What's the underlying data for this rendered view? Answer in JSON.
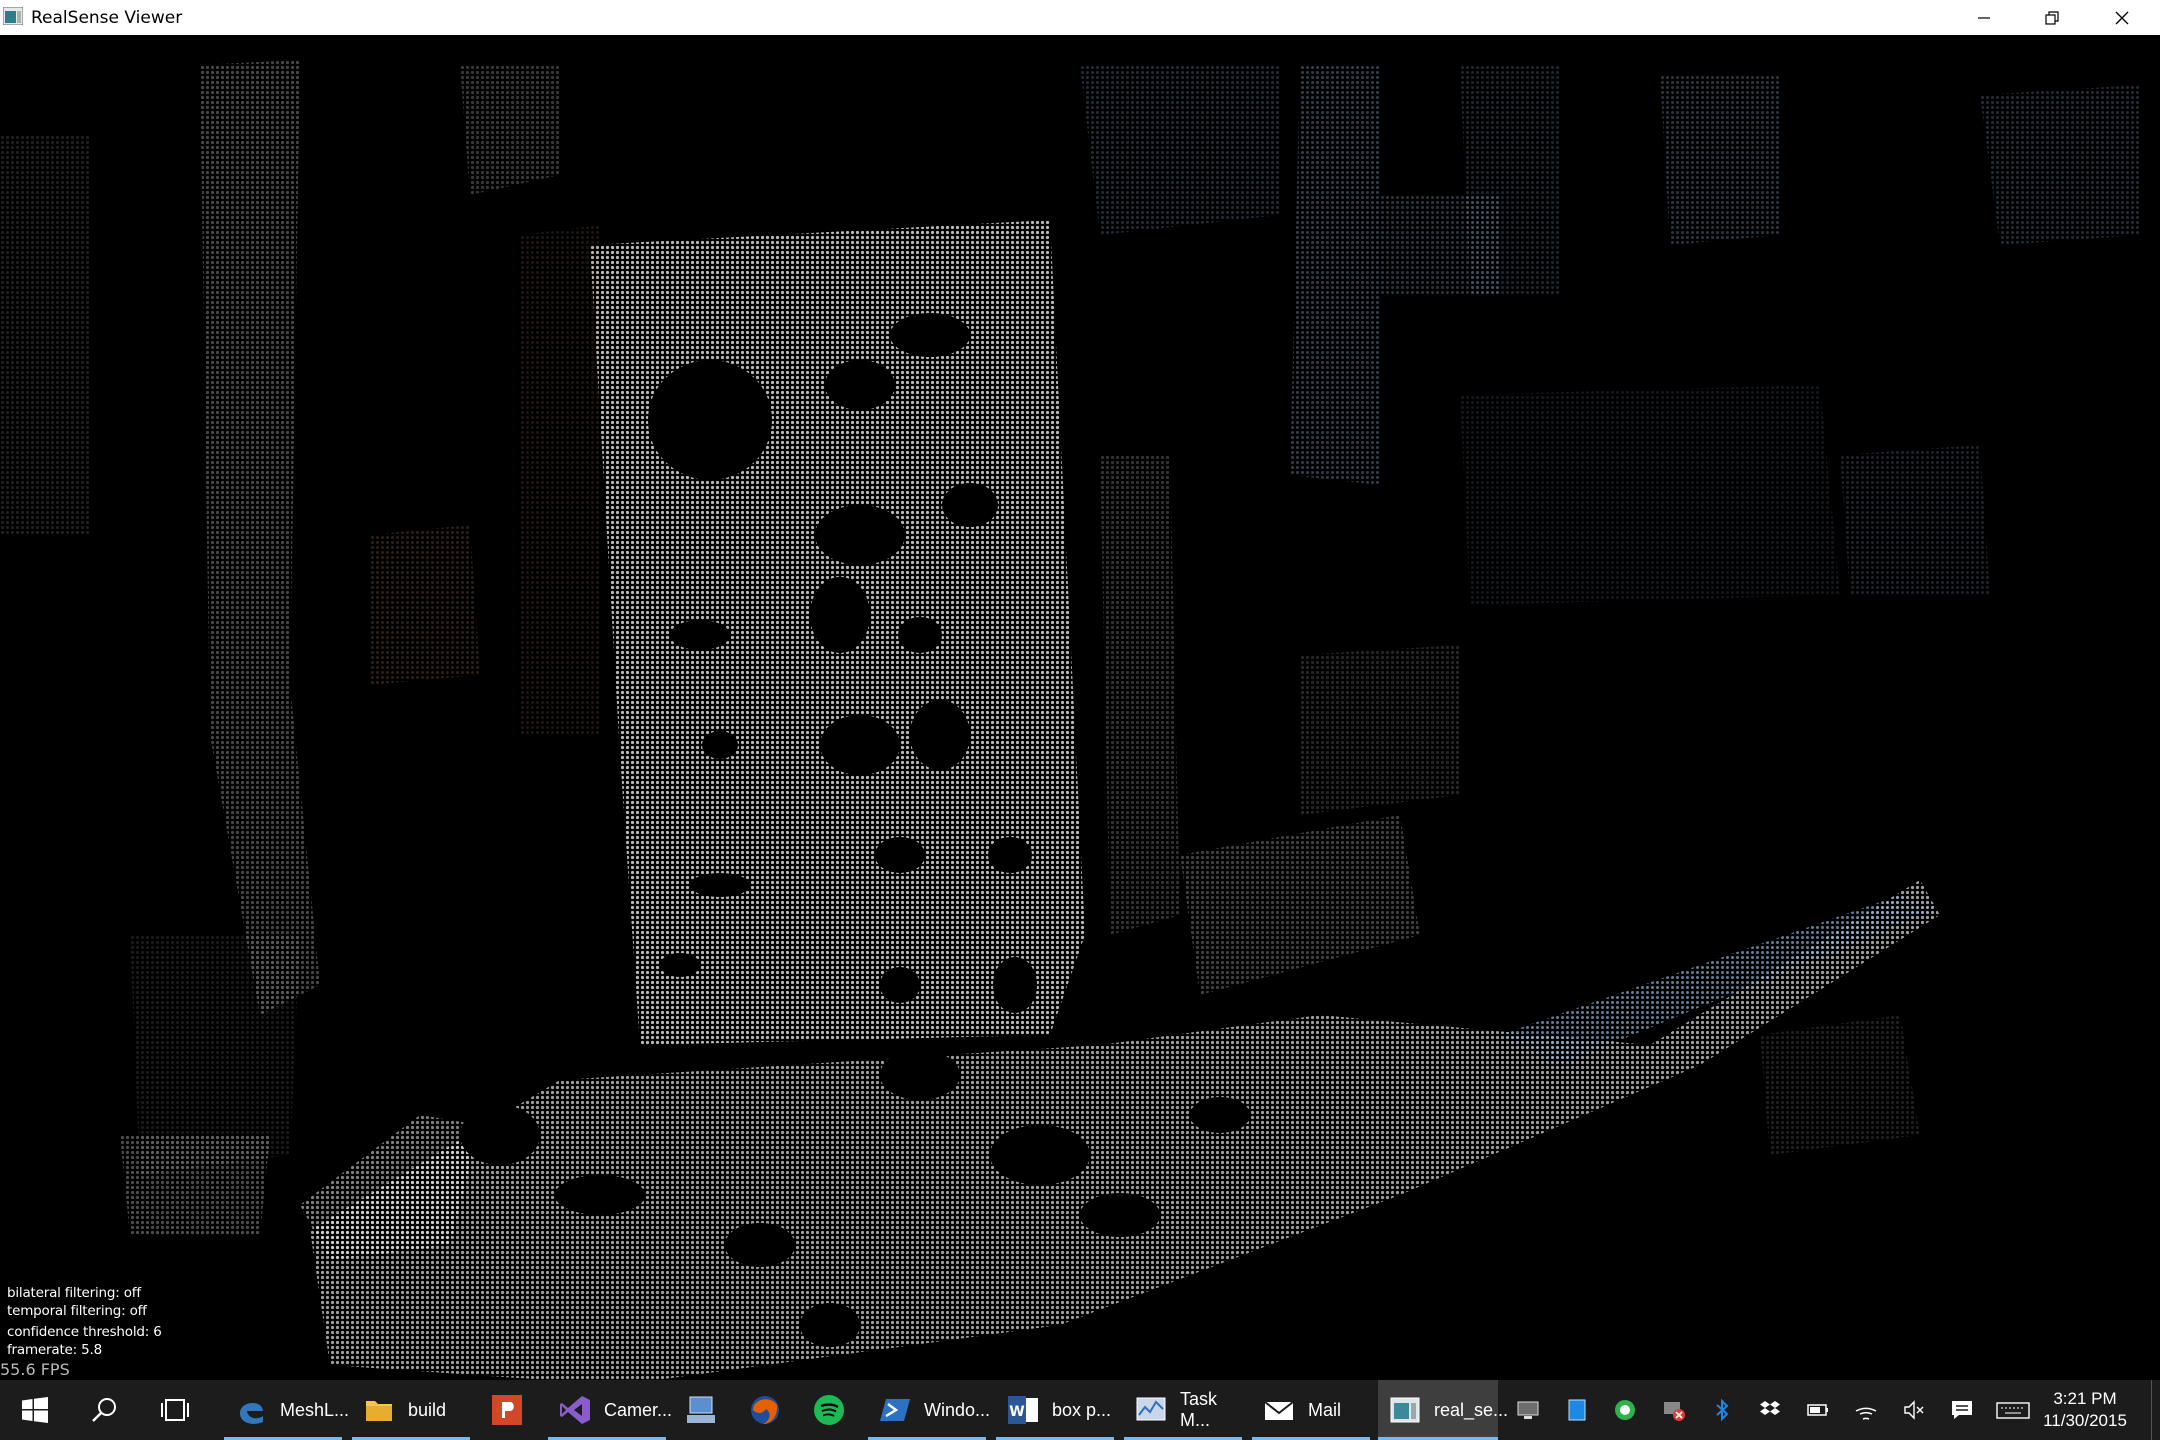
{
  "window": {
    "title": "RealSense Viewer",
    "controls": [
      "minimize-icon",
      "restore-icon",
      "close-icon"
    ]
  },
  "viewport": {
    "description_icon": "depth-point-cloud",
    "overlay": {
      "bilateral": "bilateral filtering: off",
      "temporal": "temporal filtering: off",
      "confidence": "confidence threshold: 6",
      "framerate": "framerate: 5.8"
    },
    "fps": "55.6 FPS"
  },
  "taskbar": {
    "start_icon": "windows-start-icon",
    "search_icon": "search-icon",
    "taskview_icon": "task-view-icon",
    "tasks": [
      {
        "label": "MeshL...",
        "icon": "edge-icon",
        "color": "#3277bc",
        "running": true
      },
      {
        "label": "build",
        "icon": "folder-icon",
        "color": "#f3c64c",
        "running": true
      },
      {
        "label": "",
        "icon": "powerpoint-icon",
        "color": "#d24726",
        "running": false
      },
      {
        "label": "Camer...",
        "icon": "visual-studio-icon",
        "color": "#7a4fb3",
        "running": true
      },
      {
        "label": "",
        "icon": "network-icon",
        "color": "#5b8fd0",
        "running": false
      },
      {
        "label": "",
        "icon": "firefox-icon",
        "color": "#e66000",
        "running": false
      },
      {
        "label": "",
        "icon": "spotify-icon",
        "color": "#1db954",
        "running": false
      },
      {
        "label": "Windo...",
        "icon": "powershell-icon",
        "color": "#2d71c4",
        "running": true
      },
      {
        "label": "box p...",
        "icon": "word-icon",
        "color": "#2b5797",
        "running": true
      },
      {
        "label": "Task M...",
        "icon": "task-manager-icon",
        "color": "#9ab4d4",
        "running": true
      },
      {
        "label": "Mail",
        "icon": "mail-icon",
        "color": "#ffffff",
        "running": true
      },
      {
        "label": "real_se...",
        "icon": "realsense-viewer-icon",
        "color": "#3a8a9a",
        "running": true,
        "active": true
      }
    ],
    "tray_icons": [
      "monitor-icon",
      "tablet-icon",
      "whatsapp-icon",
      "network-error-icon",
      "bluetooth-icon",
      "dropbox-icon",
      "battery-icon",
      "wifi-icon",
      "volume-muted-icon",
      "action-center-icon",
      "keyboard-icon"
    ],
    "clock": {
      "time": "3:21 PM",
      "date": "11/30/2015"
    }
  }
}
